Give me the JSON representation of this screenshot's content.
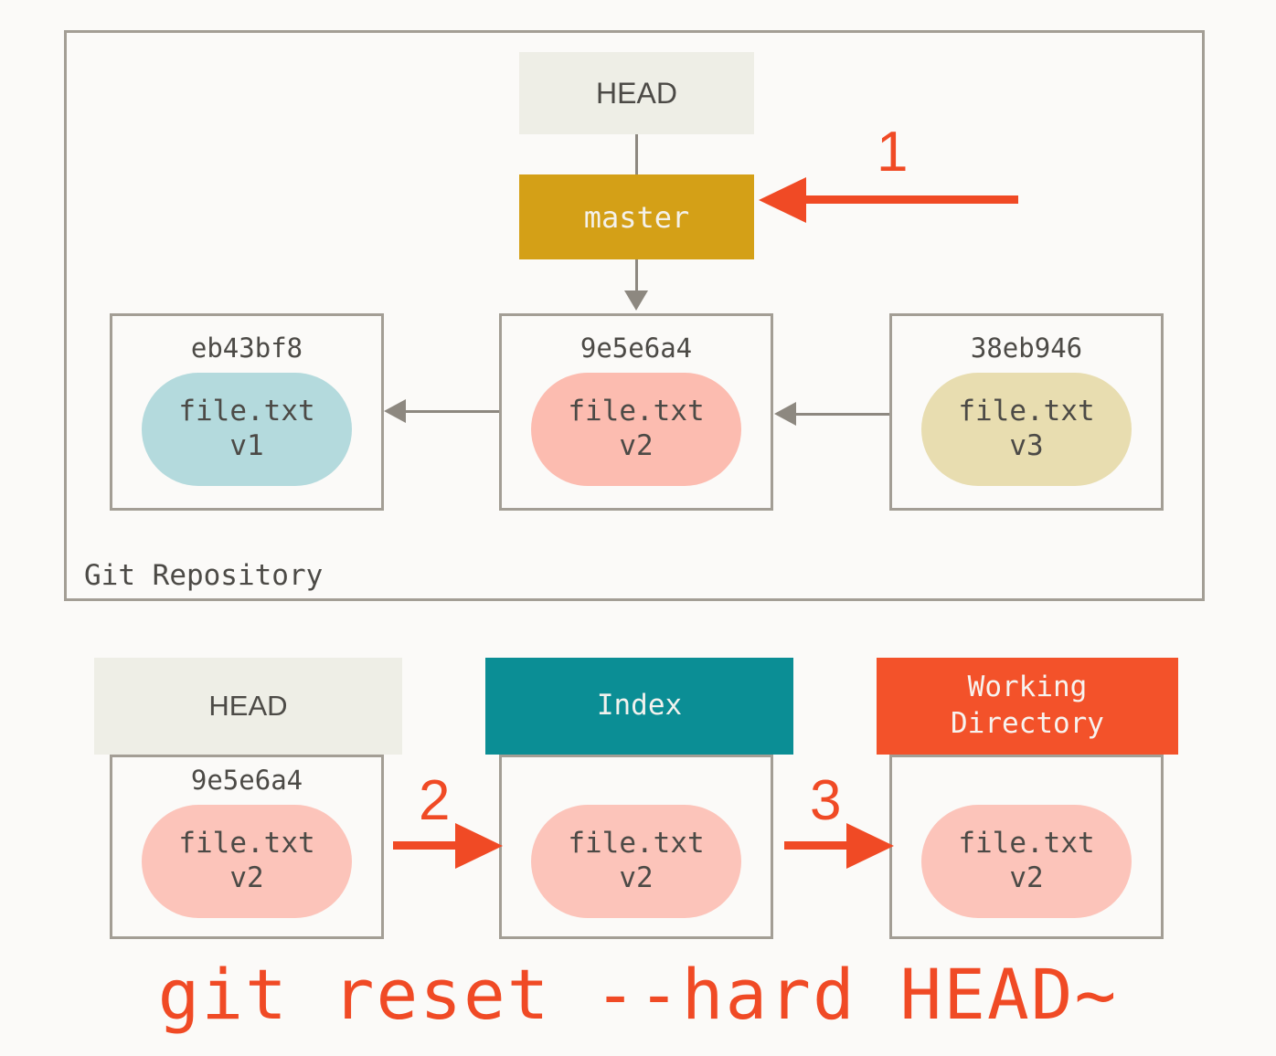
{
  "background_color": "#fbfaf8",
  "repository": {
    "label": "Git Repository",
    "border_color": "#a39e95",
    "head_pointer": {
      "label": "HEAD",
      "bg": "#eeeee6",
      "text_color": "#4c4a46"
    },
    "branch_pointer": {
      "label": "master",
      "bg": "#d4a017",
      "text_color": "#f4f1ea"
    },
    "commits": [
      {
        "hash": "eb43bf8",
        "file_name": "file.txt",
        "file_version": "v1",
        "blob_color": "#b4dadd"
      },
      {
        "hash": "9e5e6a4",
        "file_name": "file.txt",
        "file_version": "v2",
        "blob_color": "#fcbcb0"
      },
      {
        "hash": "38eb946",
        "file_name": "file.txt",
        "file_version": "v3",
        "blob_color": "#e8ddb0"
      }
    ]
  },
  "areas": [
    {
      "title": "HEAD",
      "title_lines": [
        "HEAD"
      ],
      "header_bg": "#eeeee6",
      "header_text_color": "#4c4a46",
      "hash": "9e5e6a4",
      "file_name": "file.txt",
      "file_version": "v2",
      "blob_color": "#fcc4ba"
    },
    {
      "title": "Index",
      "title_lines": [
        "Index"
      ],
      "header_bg": "#0b8e95",
      "header_text_color": "#f2f2ee",
      "hash": "",
      "file_name": "file.txt",
      "file_version": "v2",
      "blob_color": "#fcc4ba"
    },
    {
      "title": "Working Directory",
      "title_lines": [
        "Working",
        "Directory"
      ],
      "header_bg": "#f3522a",
      "header_text_color": "#f7f3ef",
      "hash": "",
      "file_name": "file.txt",
      "file_version": "v2",
      "blob_color": "#fcc4ba"
    }
  ],
  "annotations": {
    "accent_color": "#f04a25",
    "step_1": "1",
    "step_2": "2",
    "step_3": "3"
  },
  "caption": "git reset --hard HEAD~"
}
